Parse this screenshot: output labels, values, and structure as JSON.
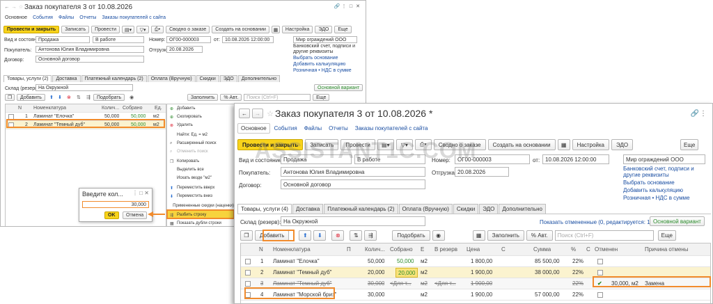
{
  "back": {
    "title": "Заказ покупателя 3 от 10.08.2026",
    "links": [
      "Основное",
      "События",
      "Файлы",
      "Отчеты",
      "Заказы покупателей с сайта"
    ],
    "toolbar": {
      "post_close": "Провести и закрыть",
      "write": "Записать",
      "post": "Провести",
      "order_info": "Сводно о заказе",
      "create_basis": "Создать на основании",
      "settings": "Настройка",
      "edo": "ЭДО",
      "more": "Еще"
    },
    "labels": {
      "type_state": "Вид и состояние:",
      "customer": "Покупатель:",
      "contract": "Договор:",
      "number": "Номер:",
      "shipment": "Отгрузка:",
      "from": "от:",
      "warehouse": "Склад (резерв):"
    },
    "values": {
      "type": "Продажа",
      "state": "В работе",
      "customer": "Антонова Юлия Владимировна",
      "contract": "Основной договор",
      "number": "ОГ00-000003",
      "date": "10.08.2026 12:00:00",
      "shipment": "20.08.2026",
      "org": "Мир ограждений ООО",
      "warehouse": "На Окружной"
    },
    "side_links": [
      "Банковский счет, подписи и другие реквизиты",
      "Выбрать основание",
      "Добавить калькуляцию",
      "Розничная • НДС в сумме"
    ],
    "tabs": [
      "Товары, услуги (2)",
      "Доставка",
      "Платежный календарь (2)",
      "Оплата (Вручную)",
      "Скидки",
      "ЭДО",
      "Дополнительно"
    ],
    "variant": "Основной вариант",
    "table_toolbar": {
      "add": "Добавить",
      "select": "Подобрать",
      "fill": "Заполнить",
      "auto_pct": "% Авт.",
      "search_ph": "Поиск (Ctrl+F)",
      "more": "Еще"
    },
    "columns": [
      "N",
      "Номенклатура",
      "Колич...",
      "Собрано",
      "Ед."
    ],
    "rows": [
      {
        "n": "1",
        "name": "Ламинат \"Елочка\"",
        "qty": "50,000",
        "collected": "50,000",
        "unit": "м2"
      },
      {
        "n": "2",
        "name": "Ламинат \"Темный дуб\"",
        "qty": "50,000",
        "collected": "50,000",
        "unit": "м2"
      }
    ],
    "menu": [
      "Добавить",
      "Скопировать",
      "Удалить",
      "Найти: Ед. = м2",
      "Расширенный поиск",
      "Отменить поиск",
      "Копировать",
      "Выделить все",
      "Искать везде \"м2\"",
      "Переместить вверх",
      "Переместить вниз",
      "Примененные скидки (наценки)",
      "Разбить строку",
      "Показать дубли строки"
    ],
    "dialog": {
      "title": "Введите кол...",
      "value": "30,000",
      "ok": "OK",
      "cancel": "Отмена"
    }
  },
  "front": {
    "title": "Заказ покупателя 3 от 10.08.2026 *",
    "links": [
      "Основное",
      "События",
      "Файлы",
      "Отчеты",
      "Заказы покупателей с сайта"
    ],
    "toolbar": {
      "post_close": "Провести и закрыть",
      "write": "Записать",
      "post": "Провести",
      "order_info": "Сводно о заказе",
      "create_basis": "Создать на основании",
      "settings": "Настройка",
      "edo": "ЭДО",
      "more": "Еще"
    },
    "labels": {
      "type_state": "Вид и состояние:",
      "customer": "Покупатель:",
      "contract": "Договор:",
      "number": "Номер:",
      "shipment": "Отгрузка:",
      "from": "от:",
      "warehouse": "Склад (резерв):"
    },
    "values": {
      "type": "Продажа",
      "state": "В работе",
      "customer": "Антонова Юлия Владимировна",
      "contract": "Основной договор",
      "number": "ОГ00-000003",
      "date": "10.08.2026 12:00:00",
      "shipment": "20.08.2026",
      "org": "Мир ограждений ООО",
      "warehouse": "На Окружной"
    },
    "side_links": [
      "Банковский счет, подписи и другие реквизиты",
      "Выбрать основание",
      "Добавить калькуляцию",
      "Розничная • НДС в сумме"
    ],
    "tabs": [
      "Товары, услуги (4)",
      "Доставка",
      "Платежный календарь (2)",
      "Оплата (Вручную)",
      "Скидки",
      "ЭДО",
      "Дополнительно"
    ],
    "show_cancelled": "Показать отмененные (0, редактируется: 1)",
    "variant": "Основной вариант",
    "table_toolbar": {
      "add": "Добавить",
      "select": "Подобрать",
      "fill": "Заполнить",
      "auto_pct": "% Авт.",
      "search_ph": "Поиск (Ctrl+F)",
      "more": "Еще"
    },
    "columns": [
      "N",
      "Номенклатура",
      "П",
      "Колич...",
      "Собрано",
      "Е",
      "В резерв",
      "Цена",
      "С",
      "Сумма",
      "%",
      "С",
      "Отменен",
      "Причина отмены"
    ],
    "rows": [
      {
        "n": "1",
        "name": "Ламинат \"Елочка\"",
        "qty": "50,000",
        "collected": "50,000",
        "unit": "м2",
        "reserve": "",
        "price": "1 800,00",
        "sum": "85 500,00",
        "vat": "22%",
        "cancel": "",
        "reason": ""
      },
      {
        "n": "2",
        "name": "Ламинат \"Темный дуб\"",
        "qty": "20,000",
        "collected": "20,000",
        "unit": "м2",
        "reserve": "",
        "price": "1 900,00",
        "sum": "38 000,00",
        "vat": "22%",
        "cancel": "",
        "reason": ""
      },
      {
        "n": "3",
        "name": "Ламинат \"Темный дуб\"",
        "qty": "30,000",
        "collected": "<Для т...",
        "unit": "м2",
        "reserve": "<Для т...",
        "price": "1 900,00",
        "sum": "",
        "vat": "22%",
        "cancel": "30,000, м2",
        "reason": "Замена"
      },
      {
        "n": "4",
        "name": "Ламинат \"Морской бриз\"",
        "qty": "30,000",
        "collected": "",
        "unit": "м2",
        "reserve": "",
        "price": "1 900,00",
        "sum": "57 000,00",
        "vat": "22%",
        "cancel": "",
        "reason": ""
      }
    ]
  },
  "watermark": "ASSISTANT1C.COM"
}
